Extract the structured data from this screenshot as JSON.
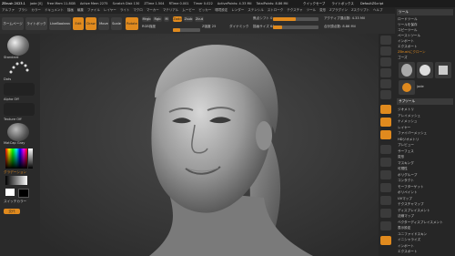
{
  "titlebar": {
    "items": [
      "ZBrush 2023.1",
      "jade [0]",
      "Free Mem 11.8GB",
      "Active Mem 2275",
      "Scratch Disk 130",
      "ZTime 1.504",
      "RTime 0.001",
      "Timer 0.022",
      "ActivePoints: 4.33 Mil",
      "TotalPoints: 8.86 Mil"
    ],
    "right_items": [
      "クイックセーブ",
      "ライトボックス",
      "DefaultZScript"
    ]
  },
  "menubar": {
    "items": [
      "アルファ",
      "ブラシ",
      "カラー",
      "ドキュメント",
      "描画",
      "編集",
      "ファイル",
      "レイヤー",
      "ライト",
      "マクロ",
      "マーカー",
      "マテリアル",
      "ムービー",
      "ピッカー",
      "環境設定",
      "レンダー",
      "ステンシル",
      "ストローク",
      "テクスチャ",
      "ツール",
      "変形",
      "Zプラグイン",
      "Zスクリプト",
      "ヘルプ"
    ]
  },
  "toolbar": {
    "home_label": "ホームページ",
    "lightbox_label": "ライトボックス",
    "liveboolean_label": "LiveBoolean",
    "edit_label": "Edit",
    "draw_label": "Draw",
    "move_label": "Move",
    "scale_label": "Scale",
    "rotate_label": "Rotate",
    "mrgb_label": "Mrgb",
    "rgb_label": "Rgb",
    "m_label": "M",
    "rgb_intensity_label": "RGB強度",
    "zadd_label": "Zadd",
    "zsub_label": "Zsub",
    "zcut_label": "Zcut",
    "focal_label": "焦点シフト 0",
    "drawsize_label": "描画サイズ 64",
    "dynamic_label": "ダイナミック",
    "z_intensity_label": "Z強度 25",
    "active_points_label": "アクティブ頂点数: 4.33 Mil",
    "total_points_label": "合計頂点数: 8.86 Mil"
  },
  "leftpanel": {
    "brush_label": "Standard",
    "stroke_label": "Dots",
    "alpha_label": "Alpha Off",
    "texture_label": "Texture Off",
    "material_label": "MatCap Gray",
    "gradient_label": "グラデーション",
    "switch_label": "スイッチカラー",
    "alternate_label": "交代"
  },
  "rightpanel": {
    "header_items": [
      "ツール",
      "ロードツール",
      "ツールを保存",
      "コピーツール",
      "ペーストツール",
      "インポート",
      "エクスポート",
      "ZBrushにクローン",
      "ゴーズ"
    ],
    "tool_label": "jade",
    "subtool_header": "サブツール",
    "items": [
      "サブツール",
      "ジオメトリ",
      "アレイメッシュ",
      "ナノメッシュ",
      "レイヤー",
      "ファイバーメッシュ",
      "HDジオメトリ",
      "プレビュー",
      "サーフェス",
      "変形",
      "マスキング",
      "可視性",
      "ポリグループ",
      "コンタクト",
      "モーフターゲット",
      "ポリペイント",
      "UVマップ",
      "テクスチャマップ",
      "ディスプレイスメント",
      "法線マップ",
      "ベクターディスプレイスメント",
      "表示設定",
      "ユニファイドスキン",
      "イニシャライズ",
      "インポート",
      "エクスポート"
    ]
  },
  "colors": {
    "accent": "#e08a1e",
    "bg": "#2b2b2b",
    "canvas": "#333333"
  }
}
